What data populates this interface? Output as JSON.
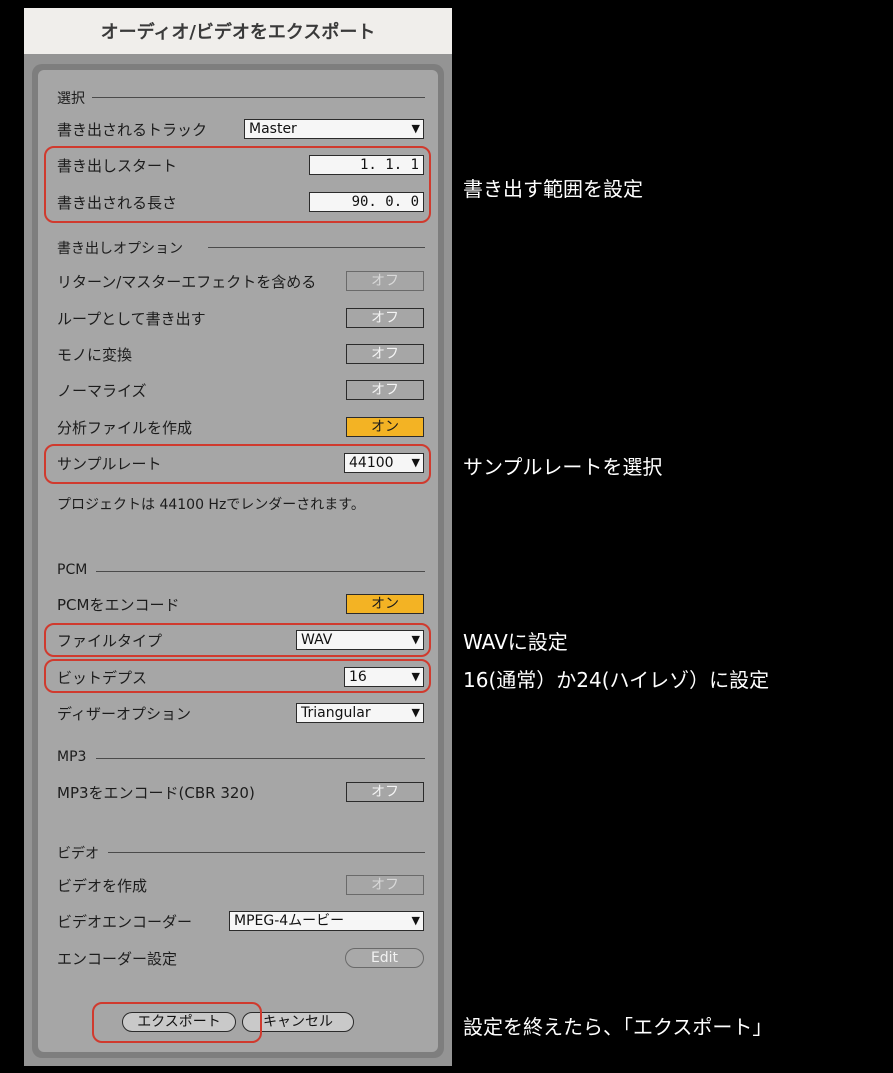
{
  "title": "オーディオ/ビデオをエクスポート",
  "selection": {
    "section_label": "選択",
    "track_label": "書き出されるトラック",
    "track_value": "Master",
    "start_label": "書き出しスタート",
    "start_value": "1. 1. 1",
    "length_label": "書き出される長さ",
    "length_value": "90. 0. 0"
  },
  "options": {
    "section_label": "書き出しオプション",
    "return_master_label": "リターン/マスターエフェクトを含める",
    "return_master_value": "オフ",
    "loop_label": "ループとして書き出す",
    "loop_value": "オフ",
    "mono_label": "モノに変換",
    "mono_value": "オフ",
    "normalize_label": "ノーマライズ",
    "normalize_value": "オフ",
    "analysis_label": "分析ファイルを作成",
    "analysis_value": "オン",
    "sample_rate_label": "サンプルレート",
    "sample_rate_value": "44100",
    "render_info": "プロジェクトは 44100 Hzでレンダーされます。"
  },
  "pcm": {
    "section_label": "PCM",
    "encode_label": "PCMをエンコード",
    "encode_value": "オン",
    "file_type_label": "ファイルタイプ",
    "file_type_value": "WAV",
    "bit_depth_label": "ビットデプス",
    "bit_depth_value": "16",
    "dither_label": "ディザーオプション",
    "dither_value": "Triangular"
  },
  "mp3": {
    "section_label": "MP3",
    "encode_label": "MP3をエンコード(CBR 320)",
    "encode_value": "オフ"
  },
  "video": {
    "section_label": "ビデオ",
    "create_label": "ビデオを作成",
    "create_value": "オフ",
    "encoder_label": "ビデオエンコーダー",
    "encoder_value": "MPEG-4ムービー",
    "settings_label": "エンコーダー設定",
    "edit_label": "Edit"
  },
  "buttons": {
    "export": "エクスポート",
    "cancel": "キャンセル"
  },
  "annotations": {
    "range": "書き出す範囲を設定",
    "sample_rate": "サンプルレートを選択",
    "wav": "WAVに設定",
    "bit_depth": "16(通常）か24(ハイレゾ）に設定",
    "export": "設定を終えたら、「エクスポート」"
  },
  "colors": {
    "highlight": "#d03a2e",
    "on_toggle": "#f3b324",
    "panel": "#a6a6a6"
  }
}
